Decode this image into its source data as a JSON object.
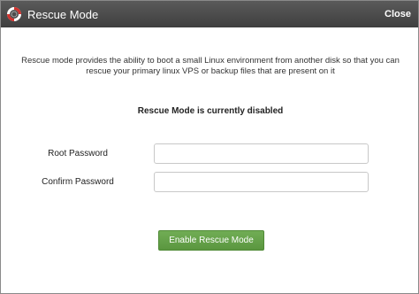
{
  "dialog": {
    "title": "Rescue Mode",
    "close_label": "Close",
    "description": "Rescue mode provides the ability to boot a small Linux environment from another disk so that you can rescue your primary linux VPS or backup files that are present on it",
    "status": "Rescue Mode is currently disabled",
    "fields": {
      "root_password": {
        "label": "Root Password",
        "value": ""
      },
      "confirm_password": {
        "label": "Confirm Password",
        "value": ""
      }
    },
    "submit_label": "Enable Rescue Mode"
  },
  "icons": {
    "title": "lifebuoy-icon"
  },
  "colors": {
    "titlebar": "#4a4a4a",
    "button": "#65a24a",
    "lifebuoy_red": "#d0312d"
  }
}
